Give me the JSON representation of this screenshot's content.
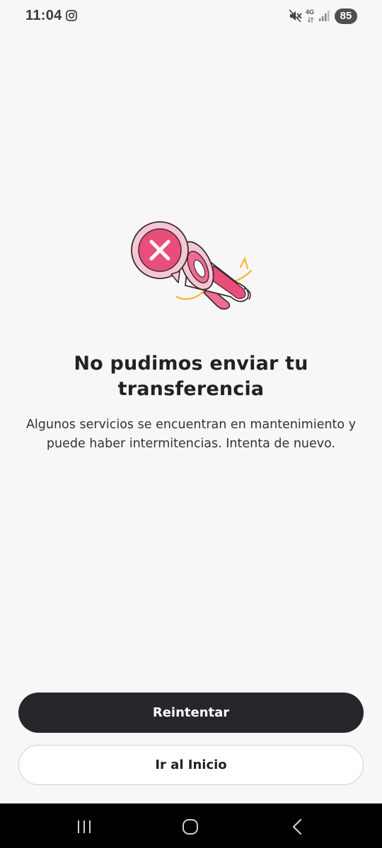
{
  "status_bar": {
    "time": "11:04",
    "network": "4G",
    "battery": "85",
    "icons": [
      "instagram-icon",
      "mute-icon",
      "4g-icon",
      "signal-icon",
      "battery-icon"
    ]
  },
  "illustration": {
    "icons": [
      "error-x-icon",
      "megaphone-icon"
    ],
    "colors": {
      "pink": "#e94e7a",
      "light_pink": "#f7c6d4",
      "yellow": "#f2b632",
      "outline": "#3a2a30"
    }
  },
  "content": {
    "title": "No pudimos enviar tu transferencia",
    "message": "Algunos servicios se encuentran en mantenimiento y puede haber intermitencias. Intenta de nuevo."
  },
  "buttons": {
    "retry_label": "Reintentar",
    "home_label": "Ir al Inicio"
  },
  "nav_bar": {
    "icons": [
      "recents-icon",
      "home-icon",
      "back-icon"
    ]
  },
  "colors": {
    "background": "#f7f7f7",
    "primary_button": "#26262b",
    "secondary_button_border": "#cfcfcf"
  }
}
